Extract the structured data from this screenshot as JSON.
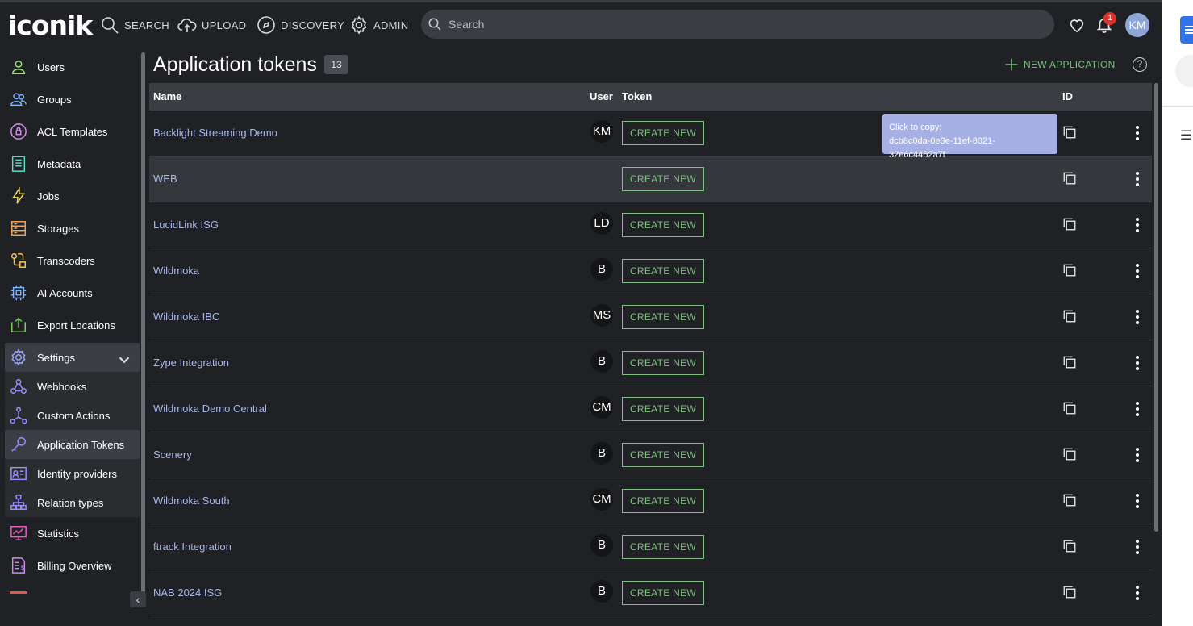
{
  "app": {
    "logo": "iconik"
  },
  "nav": {
    "search": "SEARCH",
    "upload": "UPLOAD",
    "discovery": "DISCOVERY",
    "admin": "ADMIN",
    "search_placeholder": "Search",
    "notification_count": "1",
    "user_initials": "KM"
  },
  "sidebar": {
    "items": [
      {
        "label": "Users",
        "icon": "user-icon",
        "color": "#9be37a"
      },
      {
        "label": "Groups",
        "icon": "group-icon",
        "color": "#7fb2ff"
      },
      {
        "label": "ACL Templates",
        "icon": "acl-icon",
        "color": "#d58cf0"
      },
      {
        "label": "Metadata",
        "icon": "metadata-icon",
        "color": "#5ee0c8"
      },
      {
        "label": "Jobs",
        "icon": "bolt-icon",
        "color": "#f0e35a"
      },
      {
        "label": "Storages",
        "icon": "storage-icon",
        "color": "#f0a35a"
      },
      {
        "label": "Transcoders",
        "icon": "transcoder-icon",
        "color": "#f7c65a"
      },
      {
        "label": "AI Accounts",
        "icon": "chip-icon",
        "color": "#7fb2ff"
      },
      {
        "label": "Export Locations",
        "icon": "export-icon",
        "color": "#7ad35a"
      },
      {
        "label": "Settings",
        "icon": "gear-icon",
        "color": "#9aa6ff"
      },
      {
        "label": "Webhooks",
        "icon": "webhook-icon",
        "color": "#9a8cff"
      },
      {
        "label": "Custom Actions",
        "icon": "action-icon",
        "color": "#9a8cff"
      },
      {
        "label": "Application Tokens",
        "icon": "key-icon",
        "color": "#9a8cff"
      },
      {
        "label": "Identity providers",
        "icon": "id-card-icon",
        "color": "#9a8cff"
      },
      {
        "label": "Relation types",
        "icon": "hierarchy-icon",
        "color": "#9a8cff"
      },
      {
        "label": "Statistics",
        "icon": "statistics-icon",
        "color": "#f05ac8"
      },
      {
        "label": "Billing Overview",
        "icon": "billing-icon",
        "color": "#c88cf0"
      }
    ]
  },
  "page": {
    "title": "Application tokens",
    "count": "13",
    "new_application": "NEW APPLICATION",
    "help": "?"
  },
  "table": {
    "columns": {
      "name": "Name",
      "user": "User",
      "token": "Token",
      "id": "ID"
    },
    "create_label": "CREATE NEW",
    "rows": [
      {
        "name": "Backlight Streaming Demo",
        "user": "KM"
      },
      {
        "name": "WEB",
        "user": ""
      },
      {
        "name": "LucidLink ISG",
        "user": "LD"
      },
      {
        "name": "Wildmoka",
        "user": "B"
      },
      {
        "name": "Wildmoka IBC",
        "user": "MS"
      },
      {
        "name": "Zype Integration",
        "user": "B"
      },
      {
        "name": "Wildmoka Demo Central",
        "user": "CM"
      },
      {
        "name": "Scenery",
        "user": "B"
      },
      {
        "name": "Wildmoka South",
        "user": "CM"
      },
      {
        "name": "ftrack Integration",
        "user": "B"
      },
      {
        "name": "NAB 2024 ISG",
        "user": "B"
      }
    ]
  },
  "tooltip": {
    "line1": "Click to copy:",
    "line2": "dcb8c0da-0e3e-11ef-8021-32e6c4462a7f"
  },
  "colors": {
    "accent_green": "#7fbf7f",
    "link": "#a9b6e6",
    "background": "#1f2125"
  }
}
